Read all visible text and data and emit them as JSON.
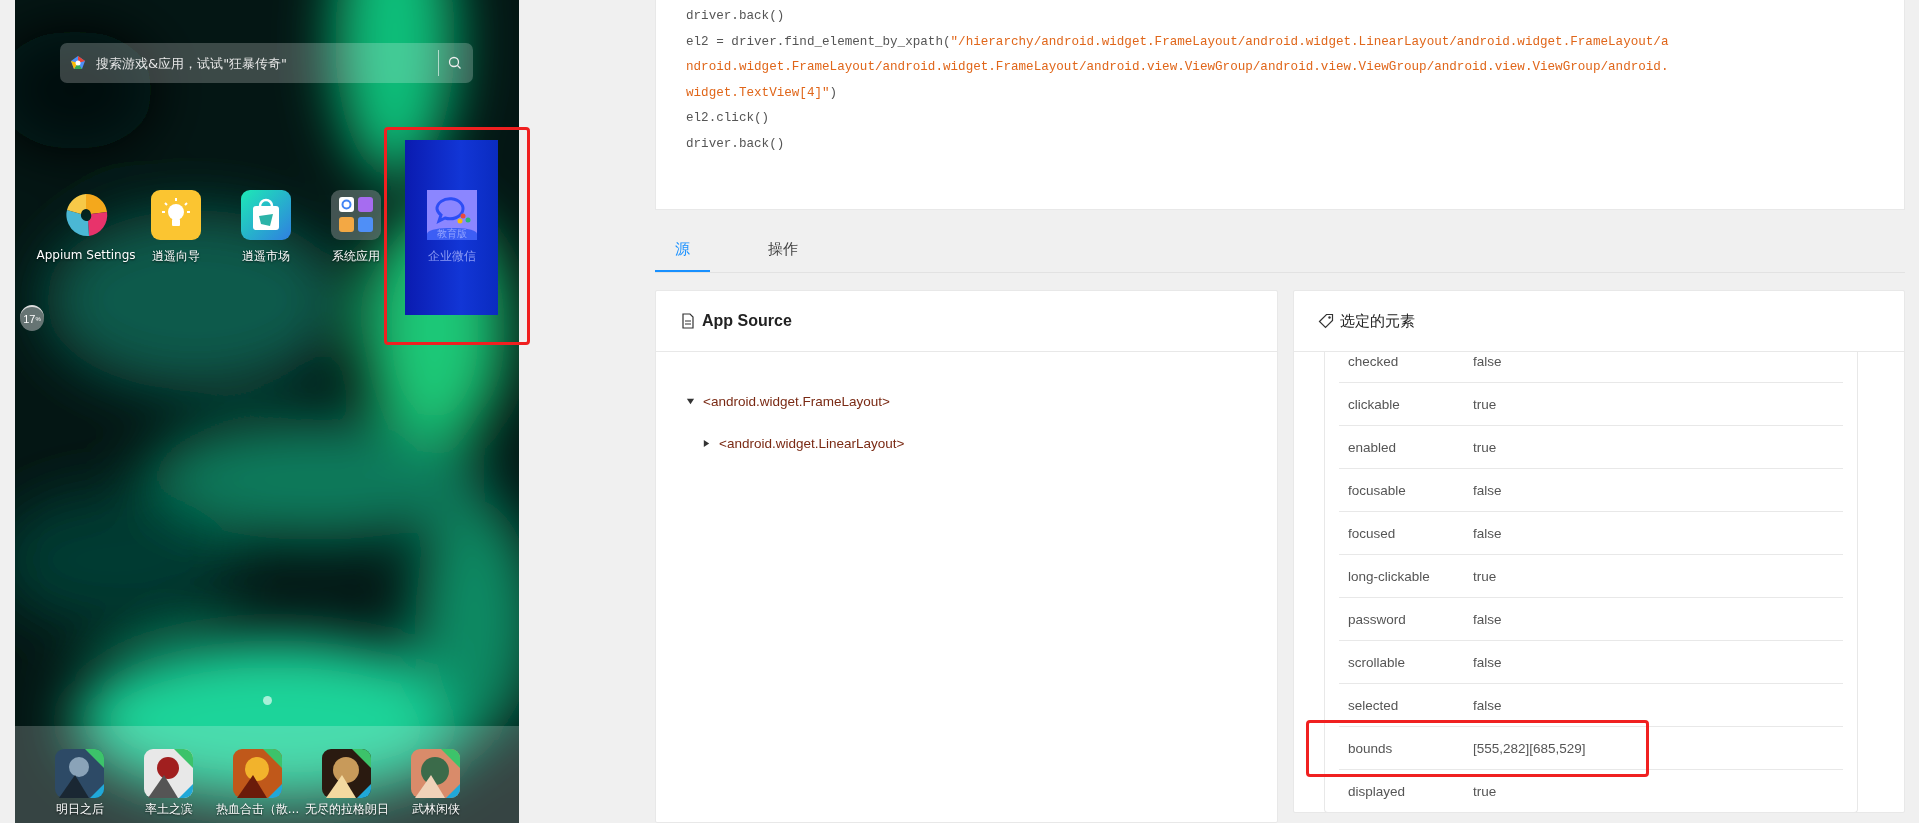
{
  "phone": {
    "search": {
      "placeholder": "搜索游戏&应用，试试\"狂暴传奇\""
    },
    "apps": [
      {
        "label": "Appium Settings",
        "kind": "appium",
        "highlighted": false
      },
      {
        "label": "逍遥向导",
        "kind": "bulb",
        "highlighted": false
      },
      {
        "label": "逍遥市场",
        "kind": "bag",
        "highlighted": false
      },
      {
        "label": "系统应用",
        "kind": "folder",
        "highlighted": false
      },
      {
        "label": "企业微信",
        "kind": "chat",
        "badge": "教育版",
        "highlighted": true
      }
    ],
    "memory_widget": "17$^{%}$",
    "dock": [
      {
        "label": "明日之后",
        "kind": "picture"
      },
      {
        "label": "率土之滨",
        "kind": "picture"
      },
      {
        "label": "热血合击（散…",
        "kind": "picture"
      },
      {
        "label": "无尽的拉格朗日",
        "kind": "picture"
      },
      {
        "label": "武林闲侠",
        "kind": "picture"
      }
    ]
  },
  "code": [
    [
      {
        "kind": "code",
        "text": "driver.back()"
      }
    ],
    [
      {
        "kind": "code",
        "text": "el2 = driver.find_element_by_xpath("
      },
      {
        "kind": "string",
        "text": "\"/hierarchy/android.widget.FrameLayout/android.widget.LinearLayout/android.widget.FrameLayout/a"
      }
    ],
    [
      {
        "kind": "string",
        "text": "ndroid.widget.FrameLayout/android.widget.FrameLayout/android.view.ViewGroup/android.view.ViewGroup/android.view.ViewGroup/android."
      }
    ],
    [
      {
        "kind": "string",
        "text": "widget.TextView[4]\""
      },
      {
        "kind": "code",
        "text": ")"
      }
    ],
    [
      {
        "kind": "code",
        "text": "el2.click()"
      }
    ],
    [
      {
        "kind": "code",
        "text": "driver.back()"
      }
    ]
  ],
  "tabs": [
    {
      "label": "源",
      "selected": true
    },
    {
      "label": "操作",
      "selected": false
    }
  ],
  "source_panel": {
    "title": "App Source",
    "tree": [
      {
        "label": "<android.widget.FrameLayout>",
        "expanded": true,
        "children": [
          {
            "label": "<android.widget.LinearLayout>",
            "expanded": false
          }
        ]
      }
    ]
  },
  "element_panel": {
    "title": "选定的元素",
    "attributes": [
      {
        "name": "checked",
        "value": "false",
        "highlighted": false
      },
      {
        "name": "clickable",
        "value": "true",
        "highlighted": false
      },
      {
        "name": "enabled",
        "value": "true",
        "highlighted": false
      },
      {
        "name": "focusable",
        "value": "false",
        "highlighted": false
      },
      {
        "name": "focused",
        "value": "false",
        "highlighted": false
      },
      {
        "name": "long-clickable",
        "value": "true",
        "highlighted": false
      },
      {
        "name": "password",
        "value": "false",
        "highlighted": false
      },
      {
        "name": "scrollable",
        "value": "false",
        "highlighted": false
      },
      {
        "name": "selected",
        "value": "false",
        "highlighted": false
      },
      {
        "name": "bounds",
        "value": "[555,282][685,529]",
        "highlighted": true
      },
      {
        "name": "displayed",
        "value": "true",
        "highlighted": false
      }
    ]
  }
}
